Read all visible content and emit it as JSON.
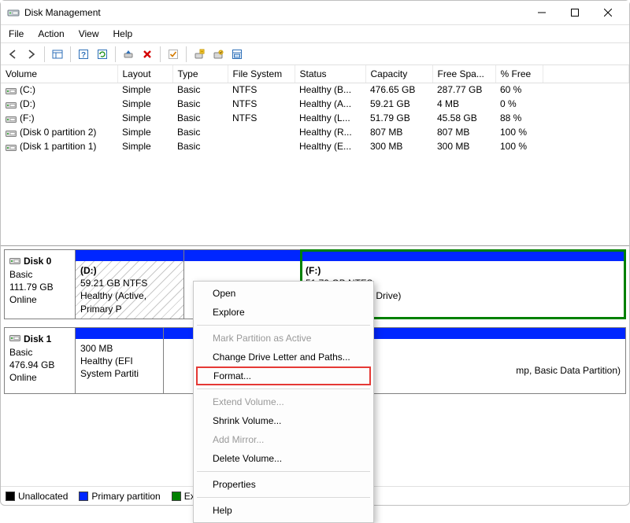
{
  "window_title": "Disk Management",
  "menubar": [
    "File",
    "Action",
    "View",
    "Help"
  ],
  "toolbar_icons": [
    "nav-back-icon",
    "nav-forward-icon",
    "sep",
    "show-hide-tree-icon",
    "sep",
    "help-icon",
    "refresh-icon",
    "sep",
    "eject-icon",
    "delete-icon",
    "sep",
    "properties-check-icon",
    "sep",
    "new-volume-icon",
    "attach-vhd-icon",
    "detach-vhd-icon"
  ],
  "table": {
    "columns": [
      "Volume",
      "Layout",
      "Type",
      "File System",
      "Status",
      "Capacity",
      "Free Spa...",
      "% Free"
    ],
    "rows": [
      {
        "vol": "(C:)",
        "layout": "Simple",
        "type": "Basic",
        "fs": "NTFS",
        "status": "Healthy (B...",
        "cap": "476.65 GB",
        "free": "287.77 GB",
        "pct": "60 %"
      },
      {
        "vol": "(D:)",
        "layout": "Simple",
        "type": "Basic",
        "fs": "NTFS",
        "status": "Healthy (A...",
        "cap": "59.21 GB",
        "free": "4 MB",
        "pct": "0 %"
      },
      {
        "vol": "(F:)",
        "layout": "Simple",
        "type": "Basic",
        "fs": "NTFS",
        "status": "Healthy (L...",
        "cap": "51.79 GB",
        "free": "45.58 GB",
        "pct": "88 %"
      },
      {
        "vol": "(Disk 0 partition 2)",
        "layout": "Simple",
        "type": "Basic",
        "fs": "",
        "status": "Healthy (R...",
        "cap": "807 MB",
        "free": "807 MB",
        "pct": "100 %"
      },
      {
        "vol": "(Disk 1 partition 1)",
        "layout": "Simple",
        "type": "Basic",
        "fs": "",
        "status": "Healthy (E...",
        "cap": "300 MB",
        "free": "300 MB",
        "pct": "100 %"
      }
    ]
  },
  "disks": [
    {
      "name": "Disk 0",
      "type": "Basic",
      "size": "111.79 GB",
      "status": "Online",
      "parts": [
        {
          "label": "(D:)",
          "line2": "59.21 GB NTFS",
          "line3": "Healthy (Active, Primary P",
          "stripe": "blue",
          "hatched": true,
          "flex": "0 0 138px"
        },
        {
          "label": "",
          "line2": "",
          "line3": "",
          "stripe": "blue",
          "hatched": false,
          "flex": "0 0 148px"
        },
        {
          "label": "(F:)",
          "line2": "51.79 GB NTFS",
          "line3": "Healthy (Logical Drive)",
          "stripe": "blue",
          "hatched": false,
          "flex": "1 1 auto",
          "selected": true
        }
      ]
    },
    {
      "name": "Disk 1",
      "type": "Basic",
      "size": "476.94 GB",
      "status": "Online",
      "parts": [
        {
          "label": "",
          "line2": "300 MB",
          "line3": "Healthy (EFI System Partiti",
          "stripe": "blue",
          "hatched": false,
          "flex": "0 0 112px"
        },
        {
          "label": "",
          "line2": "",
          "line3": "mp, Basic Data Partition)",
          "line3_pad": true,
          "stripe": "blue",
          "hatched": false,
          "flex": "1 1 auto"
        }
      ]
    }
  ],
  "context_menu": {
    "items": [
      {
        "label": "Open",
        "disabled": false
      },
      {
        "label": "Explore",
        "disabled": false
      },
      {
        "sep": true
      },
      {
        "label": "Mark Partition as Active",
        "disabled": true
      },
      {
        "label": "Change Drive Letter and Paths...",
        "disabled": false
      },
      {
        "label": "Format...",
        "disabled": false,
        "highlight": true
      },
      {
        "sep": true
      },
      {
        "label": "Extend Volume...",
        "disabled": true
      },
      {
        "label": "Shrink Volume...",
        "disabled": false
      },
      {
        "label": "Add Mirror...",
        "disabled": true
      },
      {
        "label": "Delete Volume...",
        "disabled": false
      },
      {
        "sep": true
      },
      {
        "label": "Properties",
        "disabled": false
      },
      {
        "sep": true
      },
      {
        "label": "Help",
        "disabled": false
      }
    ]
  },
  "legend": [
    {
      "color": "#000000",
      "label": "Unallocated"
    },
    {
      "color": "#0026ff",
      "label": "Primary partition"
    },
    {
      "color": "#008000",
      "label": "Extend"
    }
  ]
}
